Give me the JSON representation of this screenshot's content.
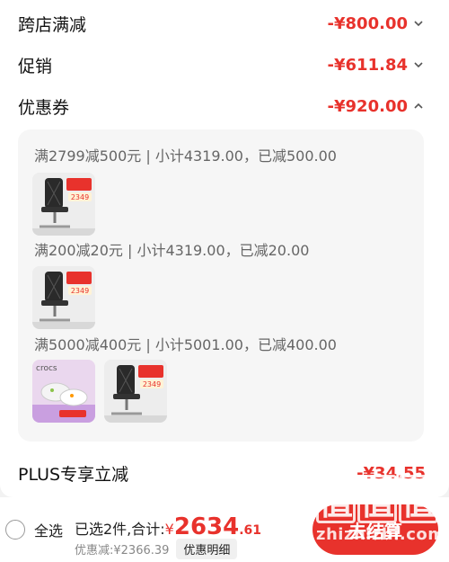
{
  "summary_rows": [
    {
      "label": "跨店满减",
      "amount": "-¥800.00",
      "expanded": false
    },
    {
      "label": "促销",
      "amount": "-¥611.84",
      "expanded": false
    },
    {
      "label": "优惠券",
      "amount": "-¥920.00",
      "expanded": true
    }
  ],
  "coupons": [
    {
      "rule": "满2799减500元 | 小计4319.00，已减500.00",
      "items": [
        "office-chair-product"
      ]
    },
    {
      "rule": "满200减20元 | 小计4319.00，已减20.00",
      "items": [
        "office-chair-product"
      ]
    },
    {
      "rule": "满5000减400元 | 小计5001.00，已减400.00",
      "items": [
        "crocs-shoes-product",
        "office-chair-product"
      ]
    }
  ],
  "thumb_badge": "2349",
  "crocs_brand": "crocs",
  "plus": {
    "label": "PLUS专享立减",
    "amount": "-¥34.55"
  },
  "bottom": {
    "select_all": "全选",
    "selected_text": "已选2件,合计:",
    "currency": "¥",
    "total_int": "2634",
    "total_dec": ".61",
    "discount_text": "优惠减:¥2366.39",
    "detail_button": "优惠明细",
    "checkout_button": "去结算"
  },
  "watermark": {
    "logo": "值值值",
    "url": "zhizhizhi.com"
  },
  "colors": {
    "accent": "#e8322c",
    "panel": "#f6f6f6",
    "muted_text": "#666666"
  },
  "icons": {
    "collapsed": "chevron-down-icon",
    "expanded": "chevron-up-icon"
  }
}
